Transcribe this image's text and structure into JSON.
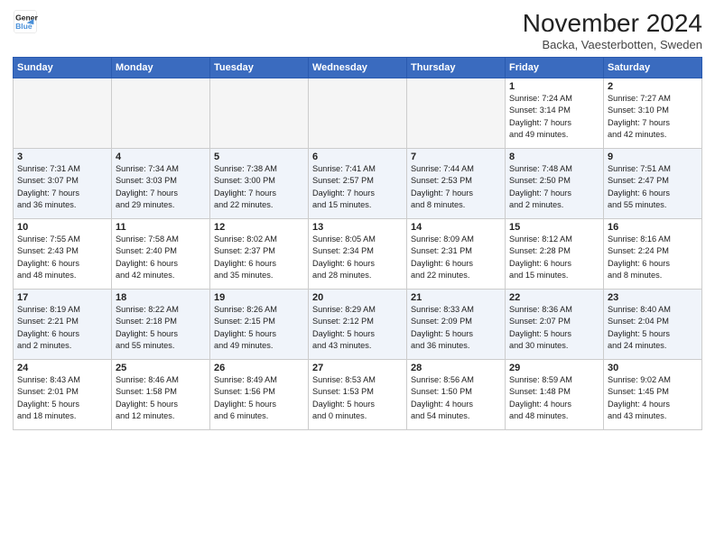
{
  "header": {
    "logo_line1": "General",
    "logo_line2": "Blue",
    "month": "November 2024",
    "location": "Backa, Vaesterbotten, Sweden"
  },
  "weekdays": [
    "Sunday",
    "Monday",
    "Tuesday",
    "Wednesday",
    "Thursday",
    "Friday",
    "Saturday"
  ],
  "weeks": [
    [
      {
        "day": "",
        "info": ""
      },
      {
        "day": "",
        "info": ""
      },
      {
        "day": "",
        "info": ""
      },
      {
        "day": "",
        "info": ""
      },
      {
        "day": "",
        "info": ""
      },
      {
        "day": "1",
        "info": "Sunrise: 7:24 AM\nSunset: 3:14 PM\nDaylight: 7 hours\nand 49 minutes."
      },
      {
        "day": "2",
        "info": "Sunrise: 7:27 AM\nSunset: 3:10 PM\nDaylight: 7 hours\nand 42 minutes."
      }
    ],
    [
      {
        "day": "3",
        "info": "Sunrise: 7:31 AM\nSunset: 3:07 PM\nDaylight: 7 hours\nand 36 minutes."
      },
      {
        "day": "4",
        "info": "Sunrise: 7:34 AM\nSunset: 3:03 PM\nDaylight: 7 hours\nand 29 minutes."
      },
      {
        "day": "5",
        "info": "Sunrise: 7:38 AM\nSunset: 3:00 PM\nDaylight: 7 hours\nand 22 minutes."
      },
      {
        "day": "6",
        "info": "Sunrise: 7:41 AM\nSunset: 2:57 PM\nDaylight: 7 hours\nand 15 minutes."
      },
      {
        "day": "7",
        "info": "Sunrise: 7:44 AM\nSunset: 2:53 PM\nDaylight: 7 hours\nand 8 minutes."
      },
      {
        "day": "8",
        "info": "Sunrise: 7:48 AM\nSunset: 2:50 PM\nDaylight: 7 hours\nand 2 minutes."
      },
      {
        "day": "9",
        "info": "Sunrise: 7:51 AM\nSunset: 2:47 PM\nDaylight: 6 hours\nand 55 minutes."
      }
    ],
    [
      {
        "day": "10",
        "info": "Sunrise: 7:55 AM\nSunset: 2:43 PM\nDaylight: 6 hours\nand 48 minutes."
      },
      {
        "day": "11",
        "info": "Sunrise: 7:58 AM\nSunset: 2:40 PM\nDaylight: 6 hours\nand 42 minutes."
      },
      {
        "day": "12",
        "info": "Sunrise: 8:02 AM\nSunset: 2:37 PM\nDaylight: 6 hours\nand 35 minutes."
      },
      {
        "day": "13",
        "info": "Sunrise: 8:05 AM\nSunset: 2:34 PM\nDaylight: 6 hours\nand 28 minutes."
      },
      {
        "day": "14",
        "info": "Sunrise: 8:09 AM\nSunset: 2:31 PM\nDaylight: 6 hours\nand 22 minutes."
      },
      {
        "day": "15",
        "info": "Sunrise: 8:12 AM\nSunset: 2:28 PM\nDaylight: 6 hours\nand 15 minutes."
      },
      {
        "day": "16",
        "info": "Sunrise: 8:16 AM\nSunset: 2:24 PM\nDaylight: 6 hours\nand 8 minutes."
      }
    ],
    [
      {
        "day": "17",
        "info": "Sunrise: 8:19 AM\nSunset: 2:21 PM\nDaylight: 6 hours\nand 2 minutes."
      },
      {
        "day": "18",
        "info": "Sunrise: 8:22 AM\nSunset: 2:18 PM\nDaylight: 5 hours\nand 55 minutes."
      },
      {
        "day": "19",
        "info": "Sunrise: 8:26 AM\nSunset: 2:15 PM\nDaylight: 5 hours\nand 49 minutes."
      },
      {
        "day": "20",
        "info": "Sunrise: 8:29 AM\nSunset: 2:12 PM\nDaylight: 5 hours\nand 43 minutes."
      },
      {
        "day": "21",
        "info": "Sunrise: 8:33 AM\nSunset: 2:09 PM\nDaylight: 5 hours\nand 36 minutes."
      },
      {
        "day": "22",
        "info": "Sunrise: 8:36 AM\nSunset: 2:07 PM\nDaylight: 5 hours\nand 30 minutes."
      },
      {
        "day": "23",
        "info": "Sunrise: 8:40 AM\nSunset: 2:04 PM\nDaylight: 5 hours\nand 24 minutes."
      }
    ],
    [
      {
        "day": "24",
        "info": "Sunrise: 8:43 AM\nSunset: 2:01 PM\nDaylight: 5 hours\nand 18 minutes."
      },
      {
        "day": "25",
        "info": "Sunrise: 8:46 AM\nSunset: 1:58 PM\nDaylight: 5 hours\nand 12 minutes."
      },
      {
        "day": "26",
        "info": "Sunrise: 8:49 AM\nSunset: 1:56 PM\nDaylight: 5 hours\nand 6 minutes."
      },
      {
        "day": "27",
        "info": "Sunrise: 8:53 AM\nSunset: 1:53 PM\nDaylight: 5 hours\nand 0 minutes."
      },
      {
        "day": "28",
        "info": "Sunrise: 8:56 AM\nSunset: 1:50 PM\nDaylight: 4 hours\nand 54 minutes."
      },
      {
        "day": "29",
        "info": "Sunrise: 8:59 AM\nSunset: 1:48 PM\nDaylight: 4 hours\nand 48 minutes."
      },
      {
        "day": "30",
        "info": "Sunrise: 9:02 AM\nSunset: 1:45 PM\nDaylight: 4 hours\nand 43 minutes."
      }
    ]
  ]
}
